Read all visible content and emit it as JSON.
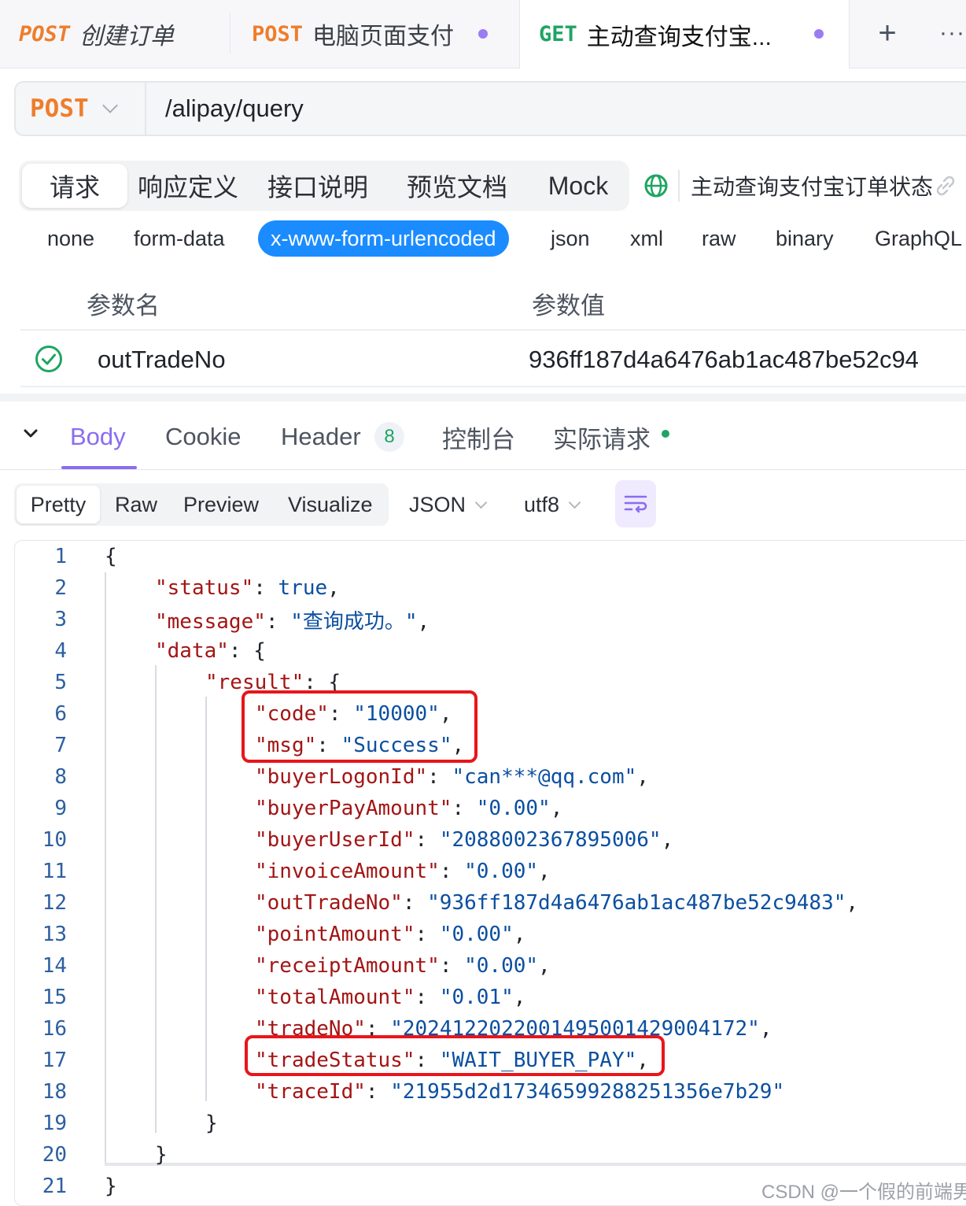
{
  "tabs": [
    {
      "method": "POST",
      "title": "创建订单",
      "italic": true
    },
    {
      "method": "POST",
      "title": "电脑页面支付",
      "modified": true
    },
    {
      "method": "GET",
      "title": "主动查询支付宝...",
      "modified": true,
      "active": true
    }
  ],
  "tab_actions": {
    "add": "+",
    "more": "···"
  },
  "url_bar": {
    "method": "POST",
    "path": "/alipay/query"
  },
  "request_tabs": [
    "请求",
    "响应定义",
    "接口说明",
    "预览文档",
    "Mock"
  ],
  "api_name": "主动查询支付宝订单状态",
  "body_types": [
    "none",
    "form-data",
    "x-www-form-urlencoded",
    "json",
    "xml",
    "raw",
    "binary",
    "GraphQL"
  ],
  "body_type_selected": "x-www-form-urlencoded",
  "params_table": {
    "headers": [
      "参数名",
      "参数值"
    ],
    "rows": [
      {
        "enabled": true,
        "name": "outTradeNo",
        "value": "936ff187d4a6476ab1ac487be52c94"
      }
    ]
  },
  "response_tabs": {
    "body": "Body",
    "cookie": "Cookie",
    "header": "Header",
    "header_count": "8",
    "console": "控制台",
    "actual_request": "实际请求"
  },
  "view_tabs": [
    "Pretty",
    "Raw",
    "Preview",
    "Visualize"
  ],
  "format_select": "JSON",
  "encoding_select": "utf8",
  "code_lines": [
    "1",
    "2",
    "3",
    "4",
    "5",
    "6",
    "7",
    "8",
    "9",
    "10",
    "11",
    "12",
    "13",
    "14",
    "15",
    "16",
    "17",
    "18",
    "19",
    "20",
    "21"
  ],
  "json_response": {
    "status": "true",
    "message": "\"查询成功。\"",
    "code": "\"10000\"",
    "msg": "\"Success\"",
    "buyerLogonId": "\"can***@qq.com\"",
    "buyerPayAmount": "\"0.00\"",
    "buyerUserId": "\"2088002367895006\"",
    "invoiceAmount": "\"0.00\"",
    "outTradeNo": "\"936ff187d4a6476ab1ac487be52c9483\"",
    "pointAmount": "\"0.00\"",
    "receiptAmount": "\"0.00\"",
    "totalAmount": "\"0.01\"",
    "tradeNo": "\"2024122022001495001429004172\"",
    "tradeStatus": "\"WAIT_BUYER_PAY\"",
    "traceId": "\"21955d2d17346599288251356e7b29\""
  },
  "json_keys": {
    "status": "\"status\"",
    "message": "\"message\"",
    "data": "\"data\"",
    "result": "\"result\"",
    "code": "\"code\"",
    "msg": "\"msg\"",
    "buyerLogonId": "\"buyerLogonId\"",
    "buyerPayAmount": "\"buyerPayAmount\"",
    "buyerUserId": "\"buyerUserId\"",
    "invoiceAmount": "\"invoiceAmount\"",
    "outTradeNo": "\"outTradeNo\"",
    "pointAmount": "\"pointAmount\"",
    "receiptAmount": "\"receiptAmount\"",
    "totalAmount": "\"totalAmount\"",
    "tradeNo": "\"tradeNo\"",
    "tradeStatus": "\"tradeStatus\"",
    "traceId": "\"traceId\""
  },
  "watermark": "CSDN @一个假的前端男",
  "colors": {
    "post": "#ef7d2b",
    "get": "#1fa463",
    "accent": "#8b6cf0",
    "active_chip": "#1a8cff",
    "highlight": "#e8151b"
  }
}
